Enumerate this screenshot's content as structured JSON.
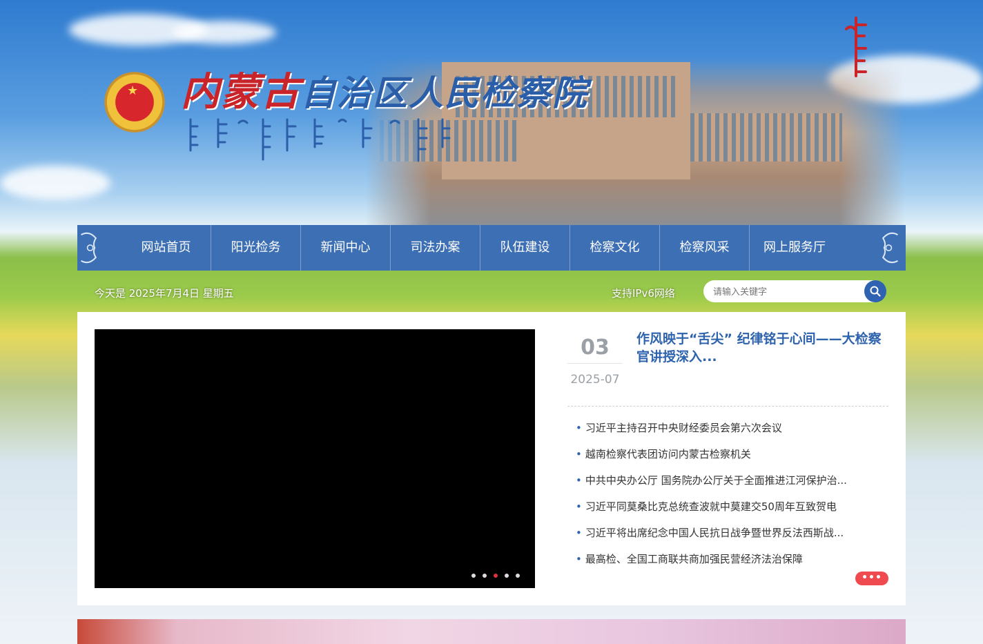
{
  "header": {
    "title_red": "内蒙古",
    "title_blue": "自治区人民检察院"
  },
  "nav": {
    "items": [
      {
        "label": "网站首页"
      },
      {
        "label": "阳光检务"
      },
      {
        "label": "新闻中心"
      },
      {
        "label": "司法办案"
      },
      {
        "label": "队伍建设"
      },
      {
        "label": "检察文化"
      },
      {
        "label": "检察风采"
      },
      {
        "label": "网上服务厅"
      }
    ]
  },
  "topbar": {
    "date_text": "今天是 2025年7月4日 星期五",
    "ipv6_text": "支持IPv6网络",
    "search_placeholder": "请输入关键字"
  },
  "slider": {
    "active_index": 2
  },
  "featured": {
    "day": "03",
    "month": "2025-07",
    "title": "作风映于“舌尖” 纪律铭于心间——大检察官讲授深入..."
  },
  "news": [
    "习近平主持召开中央财经委员会第六次会议",
    "越南检察代表团访问内蒙古检察机关",
    "中共中央办公厅 国务院办公厅关于全面推进江河保护治...",
    "习近平同莫桑比克总统查波就中莫建交50周年互致贺电",
    "习近平将出席纪念中国人民抗日战争暨世界反法西斯战...",
    "最高检、全国工商联共商加强民营经济法治保障"
  ],
  "more_label": "•••",
  "colors": {
    "nav_bg": "#3d6fb5",
    "accent_blue": "#2d62ad",
    "accent_red": "#ef4a4f"
  }
}
